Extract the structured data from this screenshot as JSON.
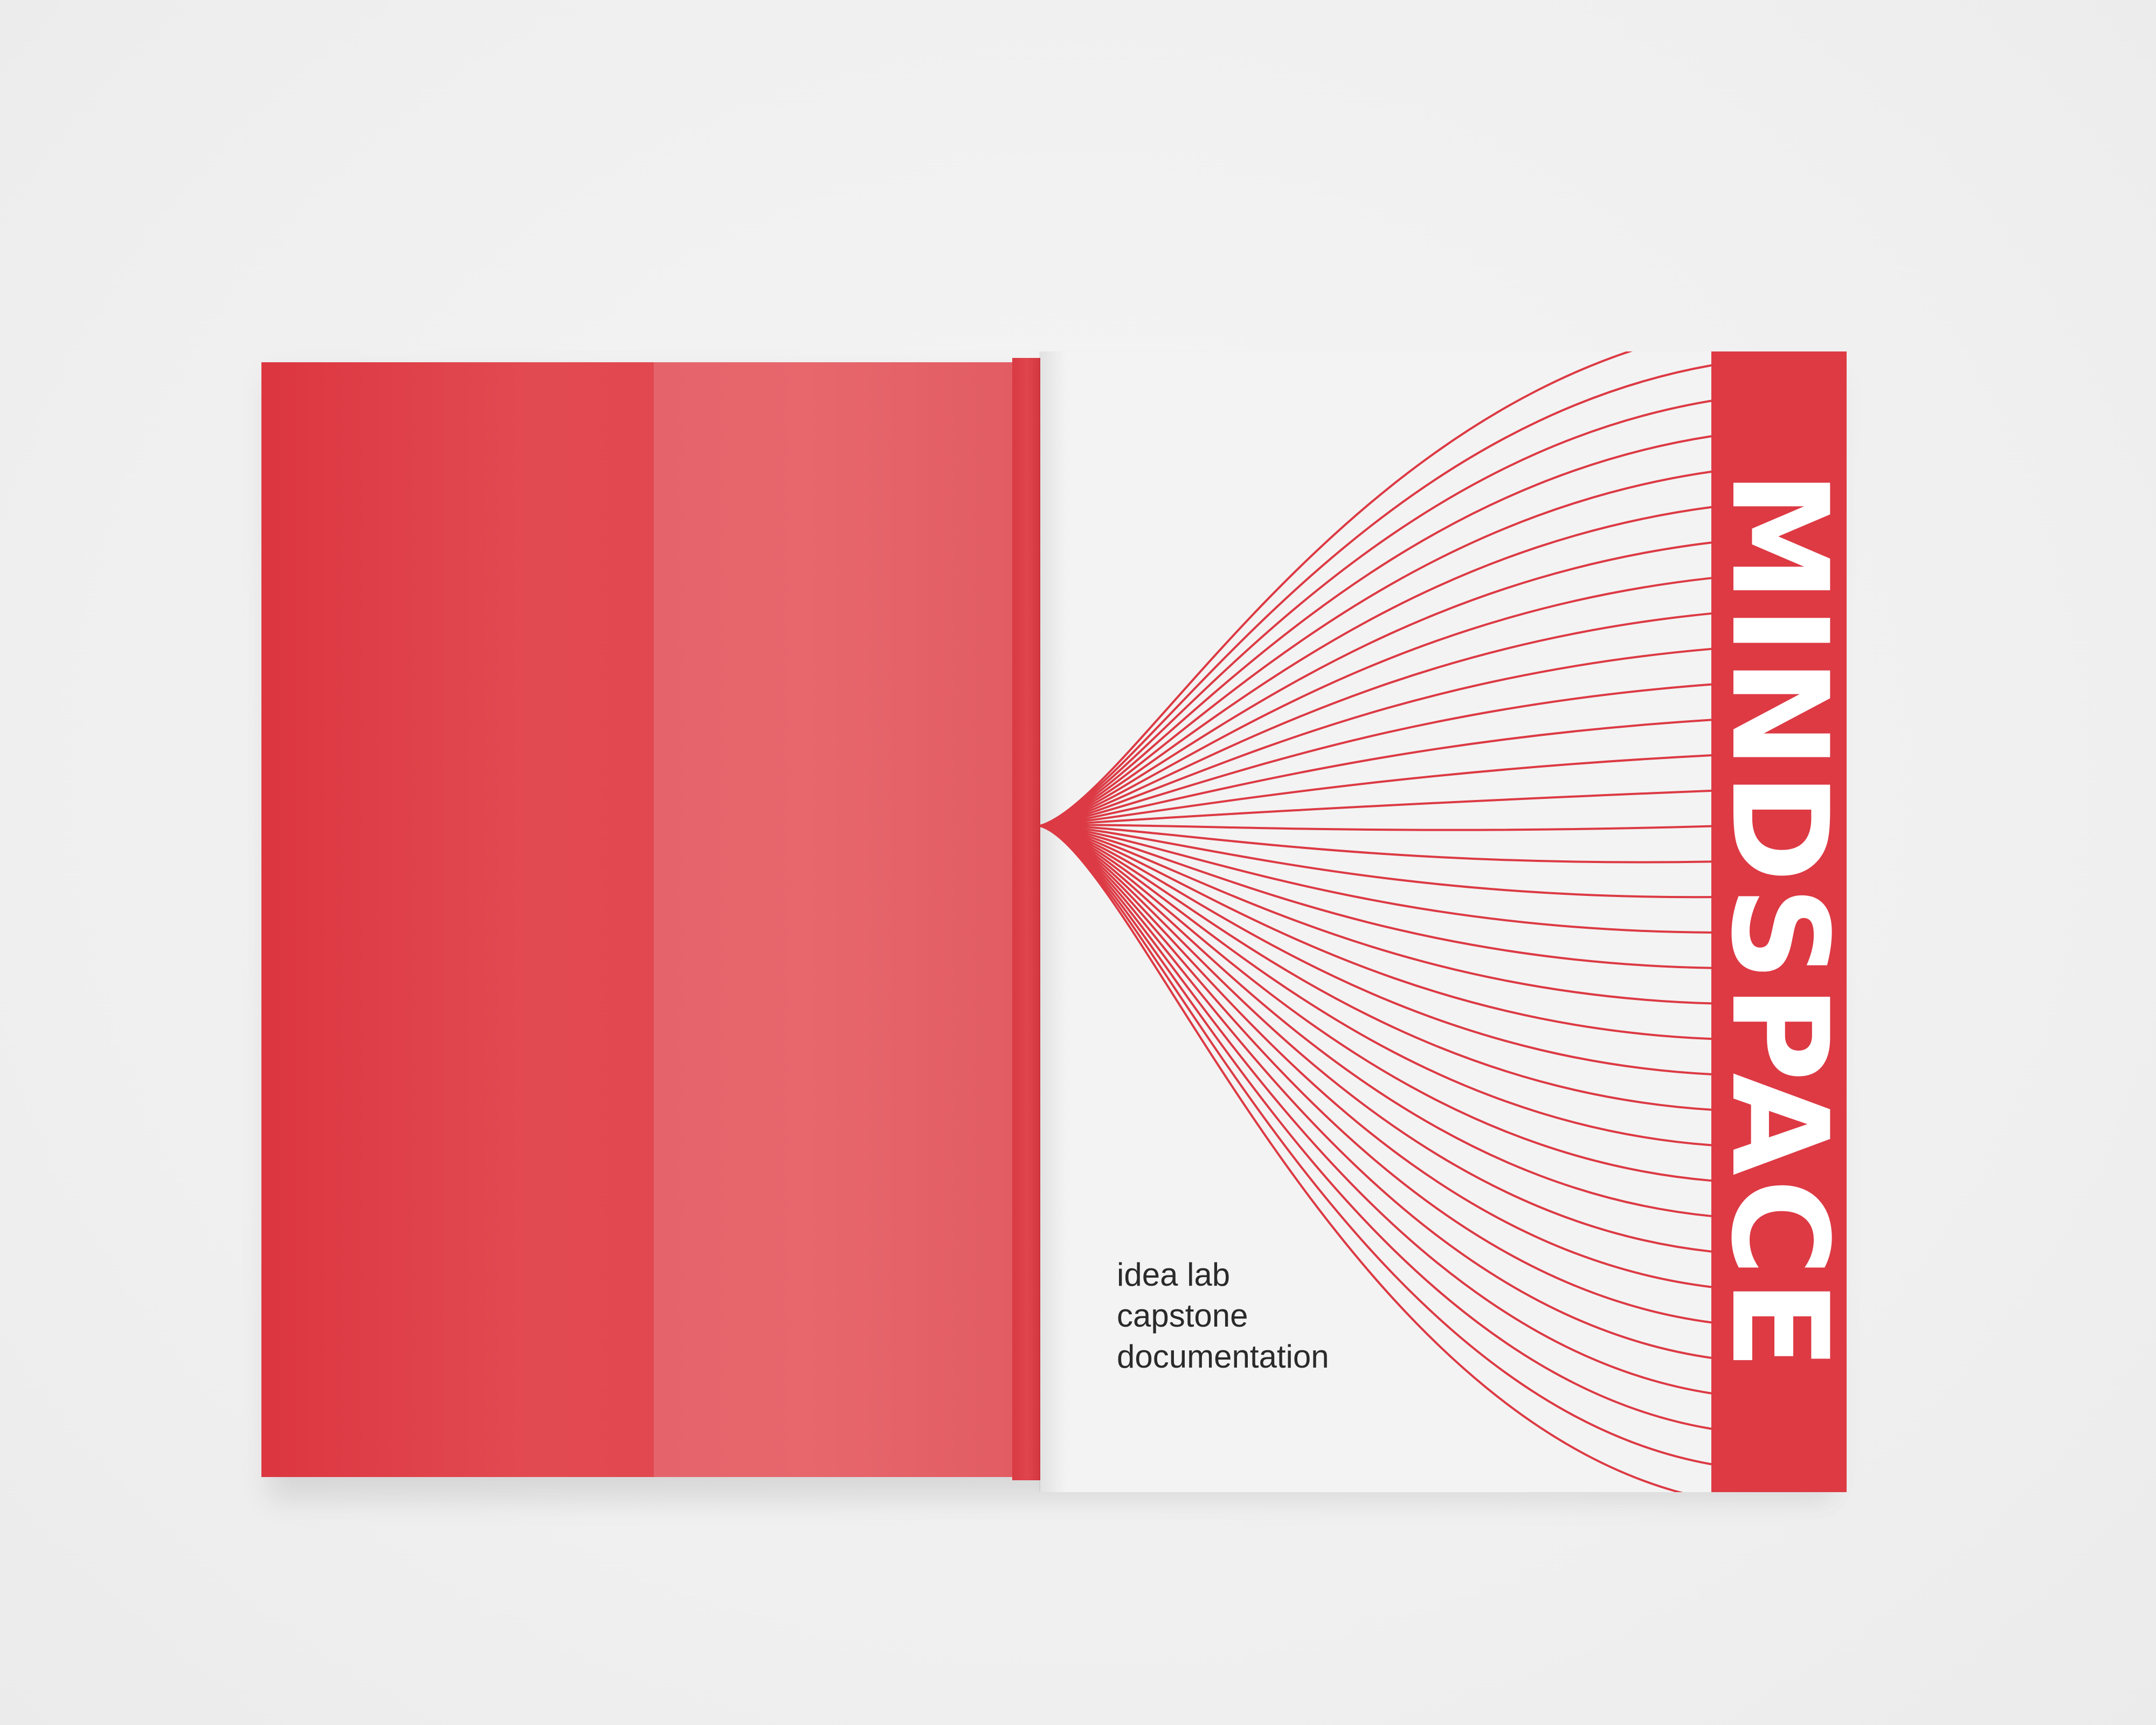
{
  "cover": {
    "title": "MINDSPACE",
    "subtitle_lines": [
      "idea lab",
      "capstone",
      "documentation"
    ]
  },
  "colors": {
    "background": "#f2f2f2",
    "brand_red": "#dd3a44",
    "back_cover_red": "#e24a52",
    "flap_red": "#e7676d",
    "front_cover_white": "#f3f3f3",
    "line_red": "#dc3a44",
    "subtitle_text": "#2a2a2a"
  }
}
